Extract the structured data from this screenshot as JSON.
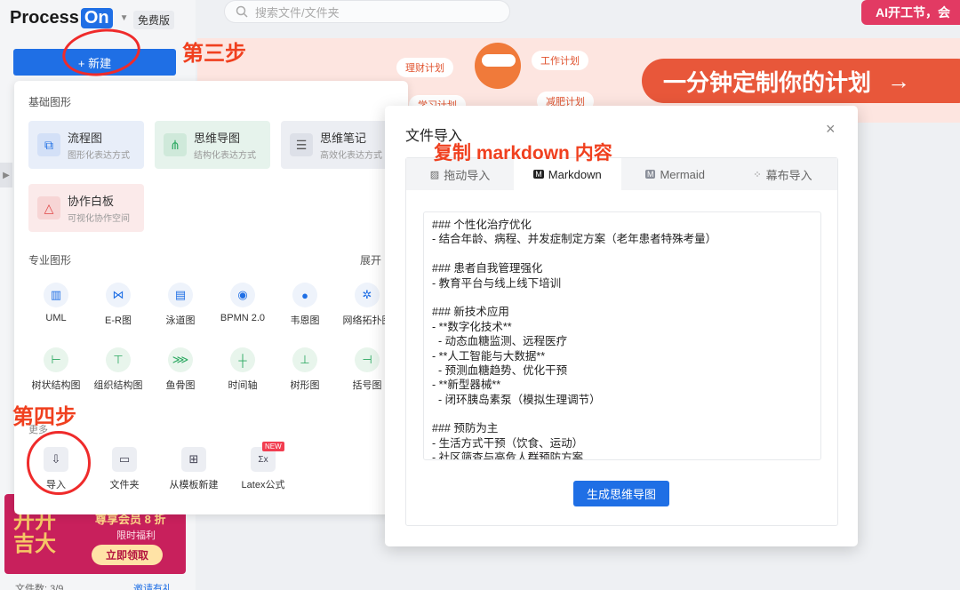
{
  "app": {
    "logo_text": "Process",
    "logo_badge": "On",
    "plan_badge": "免费版",
    "new_button": "+ 新建"
  },
  "search": {
    "placeholder": "搜索文件/文件夹"
  },
  "ai_banner": "AI开工节，会",
  "plan_banner": {
    "headline": "一分钟定制你的计划",
    "arrow": "→",
    "tags": [
      "理财计划",
      "工作计划",
      "学习计划",
      "减肥计划"
    ]
  },
  "new_panel": {
    "basic_title": "基础图形",
    "basic_cards": [
      {
        "title": "流程图",
        "sub": "图形化表达方式"
      },
      {
        "title": "思维导图",
        "sub": "结构化表达方式"
      },
      {
        "title": "思维笔记",
        "sub": "高效化表达方式"
      },
      {
        "title": "协作白板",
        "sub": "可视化协作空间"
      }
    ],
    "pro_title": "专业图形",
    "expand_label": "展开",
    "pro_items": [
      {
        "label": "UML",
        "icon": "uml-icon"
      },
      {
        "label": "E-R图",
        "icon": "er-icon"
      },
      {
        "label": "泳道图",
        "icon": "swimlane-icon"
      },
      {
        "label": "BPMN 2.0",
        "icon": "bpmn-icon"
      },
      {
        "label": "韦恩图",
        "icon": "venn-icon"
      },
      {
        "label": "网络拓扑图",
        "icon": "network-icon"
      },
      {
        "label": "树状结构图",
        "icon": "tree-icon"
      },
      {
        "label": "组织结构图",
        "icon": "org-icon"
      },
      {
        "label": "鱼骨图",
        "icon": "fishbone-icon"
      },
      {
        "label": "时间轴",
        "icon": "timeline-icon"
      },
      {
        "label": "树形图",
        "icon": "treemap-icon"
      },
      {
        "label": "括号图",
        "icon": "bracket-icon"
      }
    ],
    "more_title": "更多",
    "more_items": [
      {
        "label": "导入",
        "icon": "import-icon"
      },
      {
        "label": "文件夹",
        "icon": "folder-icon"
      },
      {
        "label": "从模板新建",
        "icon": "template-icon"
      },
      {
        "label": "Latex公式",
        "icon": "latex-icon"
      }
    ],
    "new_badge": "NEW"
  },
  "promo": {
    "big_text_1": "开开",
    "big_text_2": "吉大",
    "title": "尊享会员 8 折",
    "sub": "限时福利",
    "claim": "立即领取"
  },
  "footer": {
    "file_count": "文件数: 3/9",
    "invite": "邀请有礼"
  },
  "annotations": {
    "step3": "第三步",
    "step4": "第四步",
    "copy_md": "复制 markdown 内容"
  },
  "modal": {
    "title": "文件导入",
    "close": "×",
    "tabs": [
      {
        "label": "拖动导入",
        "icon": "image-icon"
      },
      {
        "label": "Markdown",
        "icon": "markdown-icon"
      },
      {
        "label": "Mermaid",
        "icon": "mermaid-icon"
      },
      {
        "label": "幕布导入",
        "icon": "mubu-icon"
      }
    ],
    "active_tab": "Markdown",
    "markdown_lines": [
      "### 个性化治疗优化",
      "- 结合年龄、病程、并发症制定方案（老年患者特殊考量）",
      "",
      "### 患者自我管理强化",
      "- 教育平台与线上线下培训",
      "",
      "### 新技术应用",
      "- **数字化技术**",
      "  - 动态血糖监测、远程医疗",
      "- **人工智能与大数据**",
      "  - 预测血糖趋势、优化干预",
      "- **新型器械**",
      "  - 闭环胰岛素泵（模拟生理调节）",
      "",
      "### 预防为主",
      "- 生活方式干预（饮食、运动）",
      "- 社区筛查与高危人群预防方案"
    ],
    "generate_button": "生成思维导图"
  },
  "colors": {
    "primary": "#1f6fe5",
    "annotation": "#f0401f",
    "plan_accent": "#e8573a"
  }
}
